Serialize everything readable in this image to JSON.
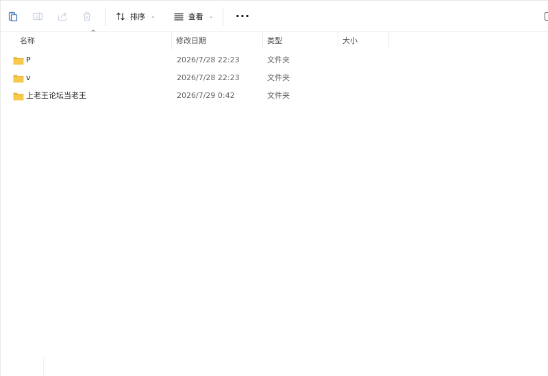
{
  "toolbar": {
    "buttons": [
      {
        "name": "paste-button",
        "icon": "paste-icon",
        "enabled": true
      },
      {
        "name": "rename-button",
        "icon": "rename-icon",
        "enabled": false
      },
      {
        "name": "share-button",
        "icon": "share-icon",
        "enabled": false
      },
      {
        "name": "delete-button",
        "icon": "trash-icon",
        "enabled": false
      }
    ],
    "sort_label": "排序",
    "view_label": "查看",
    "more_label": "···"
  },
  "columns": {
    "name": "名称",
    "date": "修改日期",
    "type": "类型",
    "size": "大小",
    "sort_indicator": "^"
  },
  "files": [
    {
      "name": "P",
      "modified": "2026/7/28 22:23",
      "type": "文件夹",
      "size": "",
      "icon": "folder-icon"
    },
    {
      "name": "v",
      "modified": "2026/7/28 22:23",
      "type": "文件夹",
      "size": "",
      "icon": "folder-icon"
    },
    {
      "name": "上老王论坛当老王",
      "modified": "2026/7/29 0:42",
      "type": "文件夹",
      "size": "",
      "icon": "folder-icon"
    }
  ],
  "colors": {
    "folder_fill": "#F6C94A",
    "folder_tab": "#E8B23A",
    "accent": "#0067C0"
  }
}
